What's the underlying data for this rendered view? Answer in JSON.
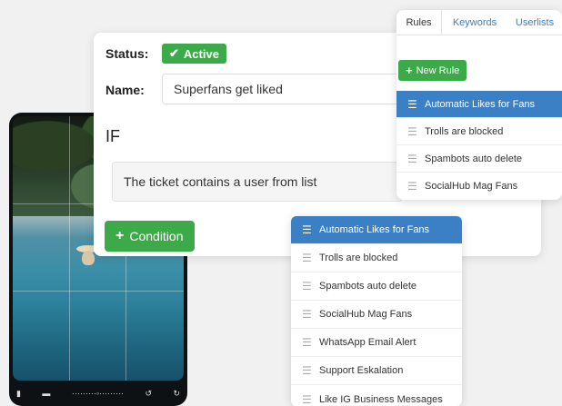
{
  "rule_editor": {
    "status_label": "Status:",
    "status_value": "Active",
    "name_label": "Name:",
    "name_value": "Superfans get liked",
    "if_label": "IF",
    "condition_text": "The ticket contains a user from list",
    "add_condition_label": "Condition"
  },
  "rules_panel": {
    "tabs": [
      {
        "label": "Rules"
      },
      {
        "label": "Keywords"
      },
      {
        "label": "Userlists"
      }
    ],
    "new_rule_label": "New Rule",
    "items": [
      {
        "label": "Automatic Likes for Fans"
      },
      {
        "label": "Trolls are blocked"
      },
      {
        "label": "Spambots auto delete"
      },
      {
        "label": "SocialHub Mag Fans"
      }
    ]
  },
  "dropdown_list": {
    "items": [
      {
        "label": "Automatic Likes for Fans"
      },
      {
        "label": "Trolls are blocked"
      },
      {
        "label": "Spambots auto delete"
      },
      {
        "label": "SocialHub Mag Fans"
      },
      {
        "label": "WhatsApp Email Alert"
      },
      {
        "label": "Support Eskalation"
      },
      {
        "label": "Like IG Business Messages"
      }
    ]
  },
  "colors": {
    "accent_green": "#3daa4a",
    "selection_blue": "#3b7fc4",
    "link_blue": "#3b7fc4"
  }
}
